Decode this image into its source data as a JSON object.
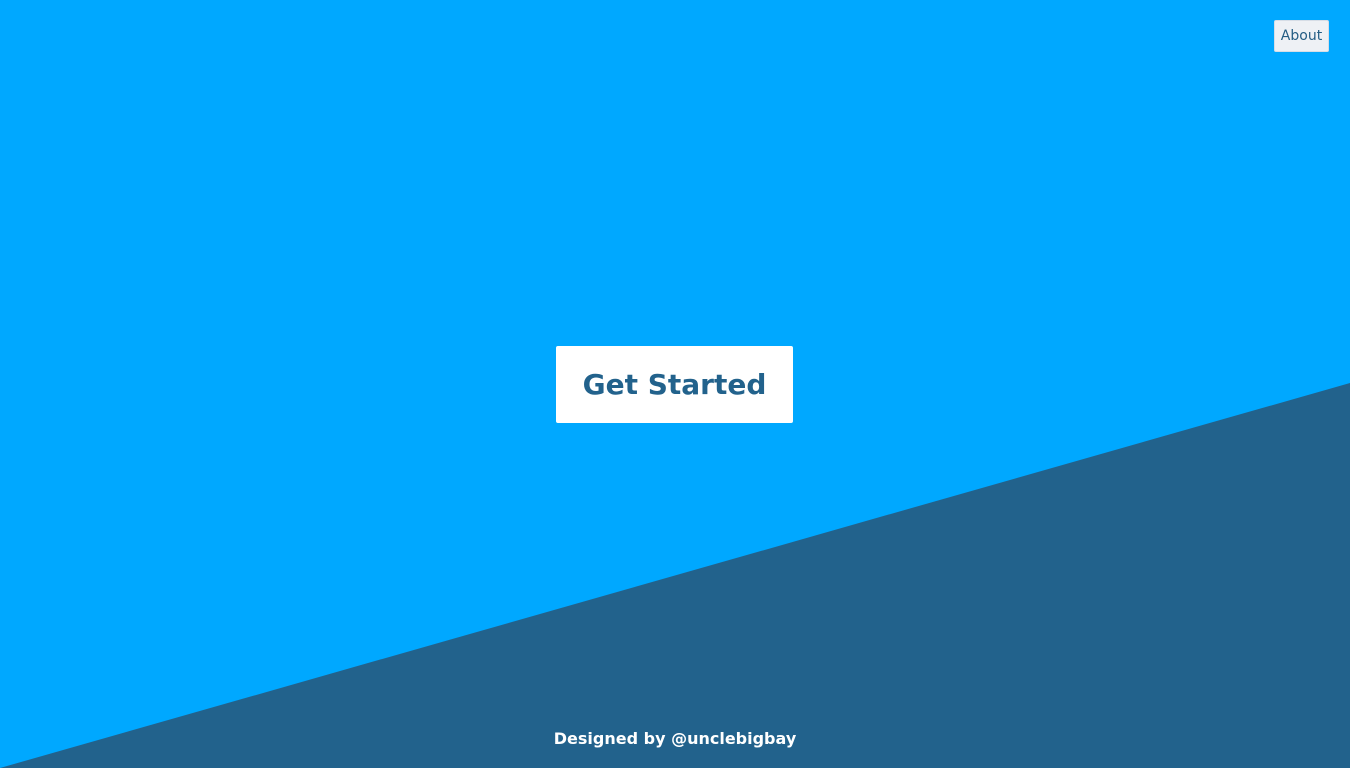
{
  "nav": {
    "about_label": "About"
  },
  "hero": {
    "cta_label": "Get Started"
  },
  "footer": {
    "credit_text": "Designed by @unclebigbay"
  },
  "colors": {
    "background": "#00a8ff",
    "slant": "#22628c",
    "cta_background": "#ffffff",
    "cta_text": "#22628c",
    "about_background": "#eef1f5",
    "about_text": "#245d84"
  }
}
